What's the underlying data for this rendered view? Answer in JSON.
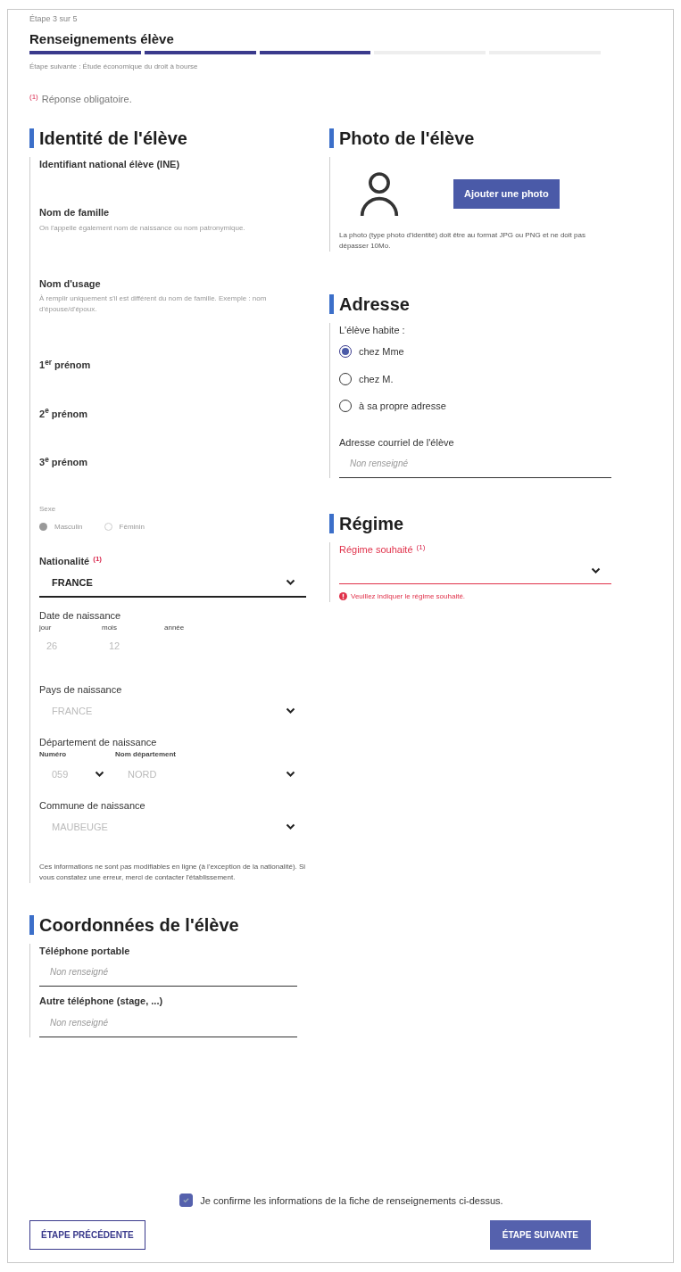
{
  "stepper": {
    "step_label": "Étape 3 sur 5",
    "title": "Renseignements élève",
    "steps": [
      {
        "done": true
      },
      {
        "done": true
      },
      {
        "done": true
      },
      {
        "done": false
      },
      {
        "done": false
      }
    ],
    "next_step": "Étape suivante : Étude économique du droit à bourse"
  },
  "required_note": {
    "mark": "(1)",
    "text": "Réponse obligatoire."
  },
  "identity": {
    "title": "Identité de l'élève",
    "fields": [
      {
        "kind": "text",
        "label": "Identifiant national élève (INE)"
      },
      {
        "kind": "text",
        "label": "Nom de famille",
        "hint": "On l'appelle également nom de naissance ou nom patronymique."
      },
      {
        "kind": "text",
        "label": "Nom d'usage",
        "hint": "À remplir uniquement s'il est différent du nom de famille. Exemple : nom d'épouse/d'époux."
      },
      {
        "kind": "text",
        "label": "1$^{er}$ prénom"
      },
      {
        "kind": "text",
        "label": "2$^{e}$ prénom"
      },
      {
        "kind": "text",
        "label": "3$^{e}$ prénom"
      },
      {
        "kind": "radio",
        "label": "Sexe",
        "options": [
          {
            "label": "Masculin",
            "selected": true
          },
          {
            "label": "Féminin",
            "selected": false
          }
        ]
      },
      {
        "kind": "select",
        "label": "Nationalité",
        "required_mark": "(1)",
        "value": "FRANCE",
        "editable": true
      },
      {
        "kind": "date",
        "label": "Date de naissance",
        "parts": [
          {
            "label": "jour",
            "value": "26"
          },
          {
            "label": "mois",
            "value": "12"
          },
          {
            "label": "année"
          }
        ]
      },
      {
        "kind": "select",
        "label": "Pays de naissance",
        "value": "FRANCE",
        "editable": false
      },
      {
        "kind": "pair",
        "label": "Département de naissance",
        "parts": [
          {
            "label": "Numéro",
            "value": "059"
          },
          {
            "label": "Nom département",
            "value": "NORD"
          }
        ]
      },
      {
        "kind": "select",
        "label": "Commune de naissance",
        "value": "MAUBEUGE",
        "editable": false
      }
    ],
    "note": "Ces informations ne sont pas modifiables en ligne (à l'exception de la nationalité). Si vous constatez une erreur, merci de contacter l'établissement."
  },
  "photo": {
    "title": "Photo de l'élève",
    "button": "Ajouter une photo",
    "note": "La photo (type photo d'identité) doit être au format JPG ou PNG et ne doit pas dépasser 10Mo."
  },
  "address": {
    "title": "Adresse",
    "question": "L'élève habite :",
    "options": [
      {
        "label": "chez Mme",
        "selected": true
      },
      {
        "label": "chez M.",
        "selected": false
      },
      {
        "label": "à sa propre adresse",
        "selected": false
      }
    ],
    "email": {
      "label": "Adresse courriel de l'élève",
      "placeholder": "Non renseigné"
    }
  },
  "regime": {
    "title": "Régime",
    "label": "Régime souhaité",
    "required_mark": "(1)",
    "invalid": true,
    "error": "Veuillez indiquer le régime souhaité."
  },
  "contact": {
    "title": "Coordonnées de l'élève",
    "fields": [
      {
        "label": "Téléphone portable",
        "placeholder": "Non renseigné"
      },
      {
        "label": "Autre téléphone (stage, ...)",
        "placeholder": "Non renseigné"
      }
    ]
  },
  "confirm": {
    "checked": true,
    "text": "Je confirme les informations de la fiche de renseignements ci-dessus."
  },
  "buttons": [
    {
      "kind": "secondary",
      "label": "ÉTAPE PRÉCÉDENTE"
    },
    {
      "kind": "primary",
      "label": "ÉTAPE SUIVANTE"
    }
  ]
}
